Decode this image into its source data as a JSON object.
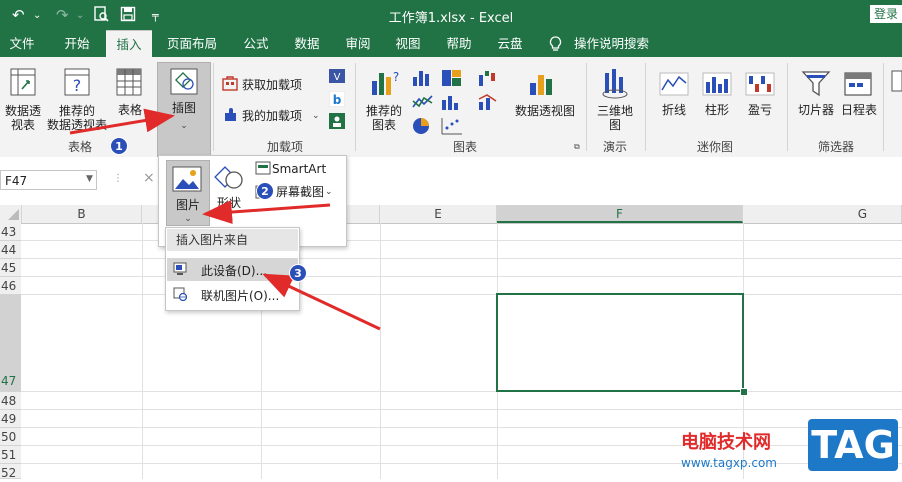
{
  "titlebar": {
    "doc_title": "工作簿1.xlsx  -  Excel",
    "login": "登录"
  },
  "tabs": [
    {
      "label": "文件"
    },
    {
      "label": "开始"
    },
    {
      "label": "插入"
    },
    {
      "label": "页面布局"
    },
    {
      "label": "公式"
    },
    {
      "label": "数据"
    },
    {
      "label": "审阅"
    },
    {
      "label": "视图"
    },
    {
      "label": "帮助"
    },
    {
      "label": "云盘"
    },
    {
      "label": "操作说明搜索"
    }
  ],
  "ribbon": {
    "pivot_table": "数据透\n视表",
    "recommended_pivot": "推荐的\n数据透视表",
    "table": "表格",
    "illustrations": "插图",
    "get_addins": "获取加载项",
    "my_addins": "我的加载项",
    "recommended_charts": "推荐的\n图表",
    "pivot_chart": "数据透视图",
    "map3d": "三维地\n图",
    "line": "折线",
    "column": "柱形",
    "winloss": "盈亏",
    "slicer": "切片器",
    "timeline": "日程表",
    "groups": {
      "tables": "表格",
      "addins": "加载项",
      "charts": "图表",
      "tours": "演示",
      "sparklines": "迷你图",
      "filters": "筛选器"
    }
  },
  "namebox": "F47",
  "columns": [
    "B",
    "E",
    "F",
    "G"
  ],
  "rows": [
    "43",
    "44",
    "45",
    "46",
    "47",
    "48",
    "49",
    "50",
    "51",
    "52"
  ],
  "illustrations_menu": {
    "pictures": "图片",
    "shapes": "形状",
    "smartart": "SmartArt",
    "screenshot": "屏幕截图"
  },
  "insert_picture_menu": {
    "header": "插入图片来自",
    "this_device": "此设备(D)...",
    "online": "联机图片(O)..."
  },
  "badges": [
    "1",
    "2",
    "3"
  ],
  "watermark": {
    "site_cn": "电脑技术网",
    "url": "www.tagxp.com",
    "logo": "TAG"
  },
  "colors": {
    "excel_green": "#217346",
    "annotation_red": "#e12b2b",
    "badge_blue": "#2a4fb8",
    "logo_blue": "#1e78c8"
  }
}
